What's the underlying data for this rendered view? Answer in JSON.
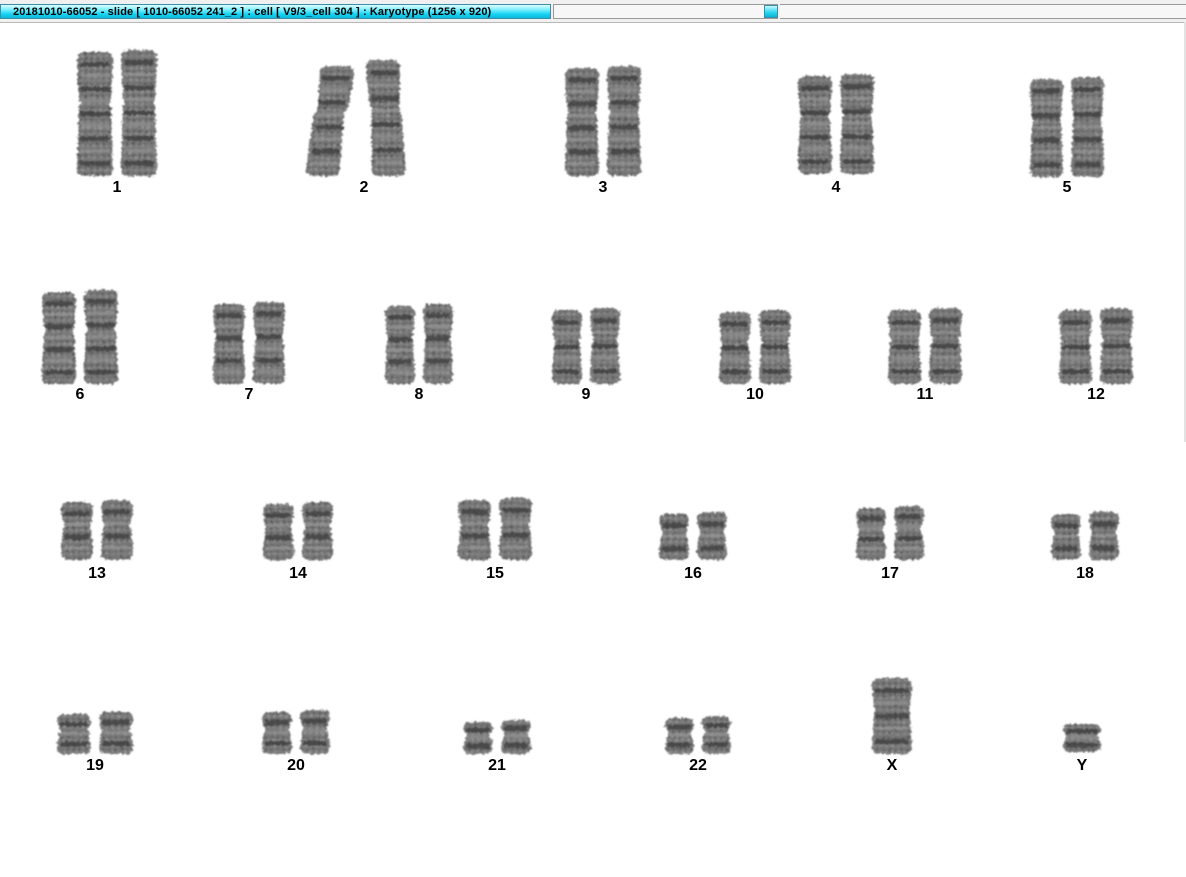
{
  "window": {
    "title": "20181010-66052 - slide [ 1010-66052 241_2 ] : cell [ V9/3_cell 304 ] : Karyotype  (1256 x 920)"
  },
  "karyotype": {
    "chromosomes": [
      {
        "label": "1",
        "shape": "large",
        "pair": 2
      },
      {
        "label": "2",
        "shape": "bent",
        "pair": 2
      },
      {
        "label": "3",
        "shape": "large",
        "pair": 2
      },
      {
        "label": "4",
        "shape": "medium",
        "pair": 2
      },
      {
        "label": "5",
        "shape": "medium",
        "pair": 2
      },
      {
        "label": "6",
        "shape": "medium",
        "pair": 2
      },
      {
        "label": "7",
        "shape": "medium",
        "pair": 2
      },
      {
        "label": "8",
        "shape": "medium",
        "pair": 2
      },
      {
        "label": "9",
        "shape": "medium",
        "pair": 2
      },
      {
        "label": "10",
        "shape": "medium",
        "pair": 2
      },
      {
        "label": "11",
        "shape": "medium",
        "pair": 2
      },
      {
        "label": "12",
        "shape": "medium",
        "pair": 2
      },
      {
        "label": "13",
        "shape": "small",
        "pair": 2
      },
      {
        "label": "14",
        "shape": "small",
        "pair": 2
      },
      {
        "label": "15",
        "shape": "small",
        "pair": 2
      },
      {
        "label": "16",
        "shape": "small",
        "pair": 2
      },
      {
        "label": "17",
        "shape": "small",
        "pair": 2
      },
      {
        "label": "18",
        "shape": "small",
        "pair": 2
      },
      {
        "label": "19",
        "shape": "tiny",
        "pair": 2
      },
      {
        "label": "20",
        "shape": "tiny",
        "pair": 2
      },
      {
        "label": "21",
        "shape": "tiny",
        "pair": 2
      },
      {
        "label": "22",
        "shape": "tiny",
        "pair": 2
      },
      {
        "label": "X",
        "shape": "medium",
        "pair": 1
      },
      {
        "label": "Y",
        "shape": "tiny",
        "pair": 1
      }
    ]
  },
  "colors": {
    "title_gradient_top": "#dffcff",
    "title_gradient_bottom": "#0cb7da",
    "chromosome_dark": "#3a3a3a",
    "chromosome_light": "#9a9a9a"
  }
}
